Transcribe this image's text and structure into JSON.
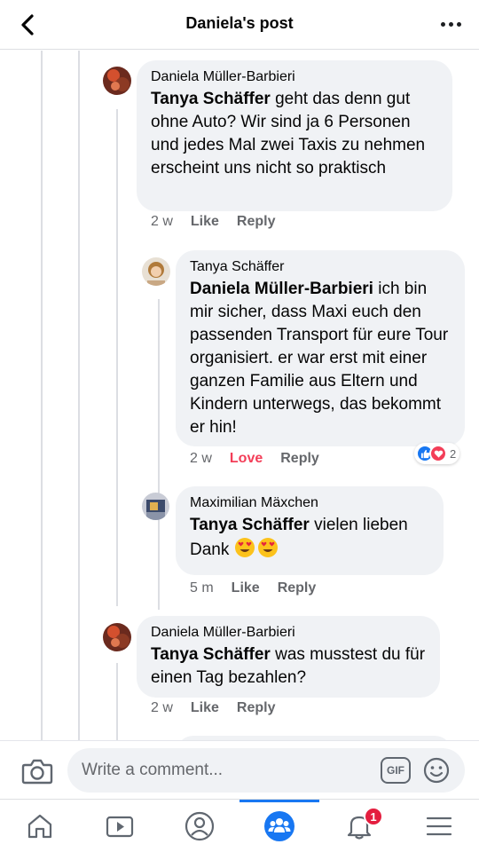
{
  "header": {
    "title": "Daniela's post",
    "back_icon": "chevron-left-icon",
    "more_icon": "more-horizontal-icon"
  },
  "comments": [
    {
      "author": "Daniela Müller-Barbieri",
      "mention": "Tanya Schäffer",
      "text": " geht das denn gut ohne Auto? Wir sind ja 6 Personen und jedes Mal zwei Taxis zu nehmen erscheint uns nicht so praktisch",
      "time": "2 w",
      "like": "Like",
      "reply": "Reply"
    },
    {
      "author": "Tanya Schäffer",
      "mention": "Daniela Müller-Barbieri",
      "text": " ich bin mir sicher, dass Maxi euch den passenden Transport für eure Tour organisiert. er war erst mit  einer ganzen Familie aus Eltern und Kindern unterwegs, das bekommt er hin!",
      "time": "2 w",
      "like": "Love",
      "reply": "Reply",
      "reaction_count": "2",
      "reaction_types": [
        "like",
        "love"
      ]
    },
    {
      "author": "Maximilian Mäxchen",
      "mention": "Tanya Schäffer",
      "text": " vielen lieben Dank ",
      "emojis": [
        "heart-eyes-emoji",
        "heart-eyes-emoji"
      ],
      "time": "5 m",
      "like": "Like",
      "reply": "Reply"
    },
    {
      "author": "Daniela Müller-Barbieri",
      "mention": "Tanya Schäffer",
      "text": " was musstest du für einen Tag bezahlen?",
      "time": "2 w",
      "like": "Like",
      "reply": "Reply"
    }
  ],
  "composer": {
    "placeholder": "Write a comment...",
    "gif_label": "GIF",
    "camera_icon": "camera-icon",
    "emoji_icon": "smiley-icon"
  },
  "tabbar": {
    "items": [
      "home-icon",
      "watch-icon",
      "profile-icon",
      "groups-icon",
      "notifications-icon",
      "menu-icon"
    ],
    "active": "groups-icon",
    "notification_badge": "1"
  },
  "colors": {
    "accent": "#1877f2",
    "love": "#f33e58",
    "bubble": "#f0f2f5",
    "secondary_text": "#65676b"
  }
}
